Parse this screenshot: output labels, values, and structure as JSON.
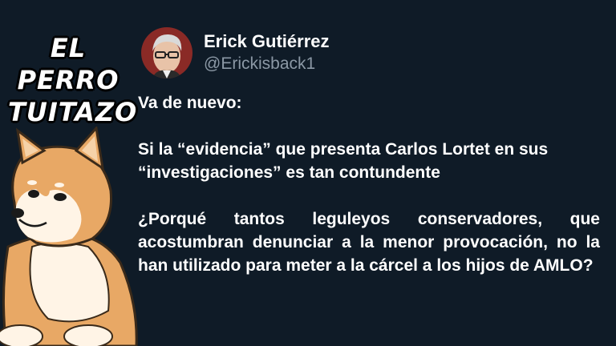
{
  "branding": {
    "line1": "EL PERRO",
    "line2": "TUITAZO"
  },
  "author": {
    "display_name": "Erick Gutiérrez",
    "handle": "@Erickisback1"
  },
  "tweet": {
    "p1": "Va de nuevo:",
    "p2": "Si la “evidencia” que presenta Carlos Lortet en sus “investigaciones” es tan contundente",
    "p3": "¿Porqué tantos leguleyos conservadores, que acostumbran denunciar a la menor provocación, no la han utilizado para meter a la cárcel a los hijos de AMLO?"
  },
  "colors": {
    "background": "#0f1b27",
    "text": "#ffffff",
    "handle": "#8b98a5"
  }
}
